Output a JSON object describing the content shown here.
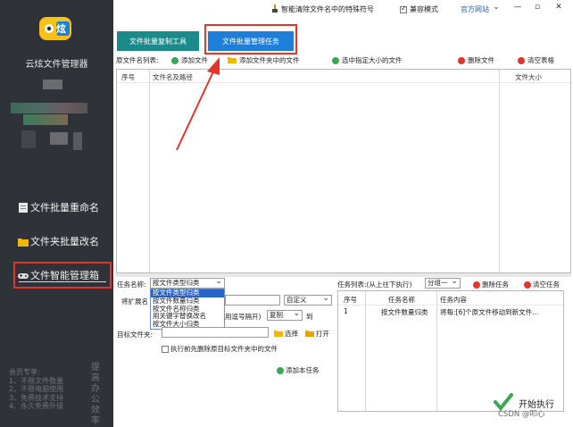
{
  "app": {
    "name": "云炫文件管理器",
    "logo_text": "炫",
    "colors": {
      "sidebar": "#2f3238",
      "accent_red": "#e0362d",
      "tab_teal": "#1a8a8a",
      "tab_blue": "#1e7fd8"
    }
  },
  "sidebar": {
    "items": [
      {
        "label": "文件批量重命名",
        "icon": "document-icon"
      },
      {
        "label": "文件夹批量改名",
        "icon": "folder-icon"
      },
      {
        "label": "文件智能管理箱",
        "icon": "gamepad-icon",
        "active": true
      }
    ],
    "promo_lines": [
      "会员专享:",
      "1、不限文件数量",
      "2、不限电脑使用",
      "3、免费技术支持",
      "4、永久免费升级"
    ],
    "promo_vertical": "提高办公效率"
  },
  "titlebar": {
    "feature_link": "智能清除文件名中的特殊符号",
    "compat_mode": "兼容模式",
    "compat_checked": true,
    "website": "官方网站",
    "buttons": [
      "⌄",
      "—",
      "▫",
      "✕"
    ]
  },
  "tabs": [
    {
      "label": "文件批量复制工具"
    },
    {
      "label": "文件批量管理任务",
      "active": true
    }
  ],
  "toolbar": {
    "source_label": "原文件名列表:",
    "add_file": "添加文件",
    "add_folder_files": "添加文件夹中的文件",
    "select_by_size": "选中指定大小的文件",
    "delete_file": "删除文件",
    "clear_table": "清空表格"
  },
  "file_table": {
    "columns": [
      "序号",
      "文件名及路径",
      "文件大小"
    ],
    "rows": []
  },
  "task_config": {
    "task_name_label": "任务名称:",
    "task_name_value": "按文件类型归类",
    "options": [
      "按文件类型归类",
      "按文件数量归类",
      "按文件名称归类",
      "用关键字替换改名",
      "按文件大小归类"
    ],
    "ext_label": "将扩展名",
    "custom_select": "自定义",
    "hint_text": "用逗号隔开)",
    "copy_select": "复制",
    "to_label": "到",
    "target_label": "目标文件夹:",
    "choose_button": "选择",
    "open_button": "打开",
    "delete_before_label": "执行前先删除原目标文件夹中的文件",
    "add_task_button": "添加本任务"
  },
  "task_list": {
    "label": "任务列表:(从上往下执行)",
    "group_select": "分组一",
    "delete_task": "删除任务",
    "clear_tasks": "清空任务",
    "columns": [
      "序号",
      "任务名称",
      "任务内容"
    ],
    "rows": [
      {
        "index": "1",
        "name": "按文件数量归类",
        "content": "将每:[6]个原文件移动到新文件..."
      }
    ]
  },
  "start_button": "开始执行",
  "watermark": "CSDN @叩心"
}
